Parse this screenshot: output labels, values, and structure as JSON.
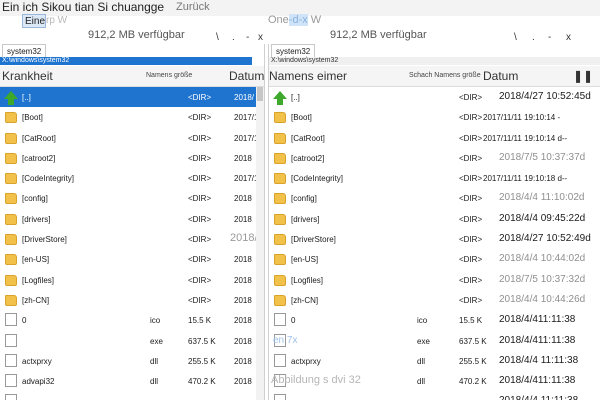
{
  "window": {
    "title": "Ein ich Sikou tian Si chuangge",
    "back_label": "Zurück"
  },
  "tabs": {
    "left_label": "Eine",
    "left_ghost": "rp W",
    "right_prefix": "One",
    "right_highlight": "-d-x",
    "right_suffix": " W"
  },
  "drive": {
    "left_free": "912,2 MB verfügbar",
    "right_free": "912,2 MB verfügbar",
    "tool_glyphs": [
      "\\",
      ".",
      "-",
      "x"
    ]
  },
  "left_panel": {
    "path_tab": "system32",
    "path": "X:\\windows\\system32",
    "headers": {
      "name": "Krankheit",
      "size": "Namens größe",
      "date": "Datum"
    },
    "rows": [
      {
        "icon": "up-arrow-icon",
        "name": "[..]",
        "type": "",
        "size": "<DIR>",
        "date": "2018/",
        "selected": true
      },
      {
        "icon": "folder-icon",
        "name": "[Boot]",
        "type": "",
        "size": "<DIR>",
        "date": "2017/1"
      },
      {
        "icon": "folder-icon",
        "name": "[CatRoot]",
        "type": "",
        "size": "<DIR>",
        "date": "2017/1"
      },
      {
        "icon": "folder-icon",
        "name": "[catroot2]",
        "type": "",
        "size": "<DIR>",
        "date": "2018"
      },
      {
        "icon": "folder-icon",
        "name": "[CodeIntegrity]",
        "type": "",
        "size": "<DIR>",
        "date": "2017/1"
      },
      {
        "icon": "folder-icon",
        "name": "[config]",
        "type": "",
        "size": "<DIR>",
        "date": "2018"
      },
      {
        "icon": "folder-icon",
        "name": "[drivers]",
        "type": "",
        "size": "<DIR>",
        "date": "2018"
      },
      {
        "icon": "folder-icon",
        "name": "[DriverStore]",
        "type": "",
        "size": "<DIR>",
        "date": "2018/"
      },
      {
        "icon": "folder-icon",
        "name": "[en-US]",
        "type": "",
        "size": "<DIR>",
        "date": "2018"
      },
      {
        "icon": "folder-icon",
        "name": "[Logfiles]",
        "type": "",
        "size": "<DIR>",
        "date": "2018"
      },
      {
        "icon": "folder-icon",
        "name": "[zh-CN]",
        "type": "",
        "size": "<DIR>",
        "date": "2018"
      },
      {
        "icon": "file-icon",
        "name": "0",
        "type": "ico",
        "size": "15.5 K",
        "date": "2018"
      },
      {
        "icon": "file-icon",
        "name": "",
        "type": "exe",
        "size": "637.5 K",
        "date": "2018"
      },
      {
        "icon": "file-icon",
        "name": "actxprxy",
        "type": "dll",
        "size": "255.5 K",
        "date": "2018"
      },
      {
        "icon": "file-icon",
        "name": "advapi32",
        "type": "dll",
        "size": "470.2 K",
        "date": "2018"
      },
      {
        "icon": "file-icon",
        "name": "",
        "type": "",
        "size": "",
        "date": ""
      }
    ]
  },
  "right_panel": {
    "path_tab": "system32",
    "path": "X:\\windows\\system32",
    "headers": {
      "name": "Namens eimer",
      "size": "Schach Namens größe",
      "date": "Datum"
    },
    "rows": [
      {
        "icon": "up-arrow-icon",
        "name": "[..]",
        "size": "<DIR>",
        "date": "2018/4/27 10:52:45d"
      },
      {
        "icon": "folder-icon",
        "name": "[Boot]",
        "size": "<DIR>",
        "date": "2017/11/11 19:10:14 -"
      },
      {
        "icon": "folder-icon",
        "name": "[CatRoot]",
        "size": "<DIR>",
        "date": "2017/11/11 19:10:14 d--"
      },
      {
        "icon": "folder-icon",
        "name": "[catroot2]",
        "size": "<DIR>",
        "date": "2018/7/5 10:37:37d"
      },
      {
        "icon": "folder-icon",
        "name": "[CodeIntegrity]",
        "size": "<DIR>",
        "date": "2017/11/11 19:10:18 d--"
      },
      {
        "icon": "folder-icon",
        "name": "[config]",
        "size": "<DIR>",
        "date": "2018/4/4 11:10:02d"
      },
      {
        "icon": "folder-icon",
        "name": "[drivers]",
        "size": "<DIR>",
        "date": "2018/4/4 09:45:22d"
      },
      {
        "icon": "folder-icon",
        "name": "[DriverStore]",
        "size": "<DIR>",
        "date": "2018/4/27 10:52:49d"
      },
      {
        "icon": "folder-icon",
        "name": "[en-US]",
        "size": "<DIR>",
        "date": "2018/4/4 10:44:02d"
      },
      {
        "icon": "folder-icon",
        "name": "[Logfiles]",
        "size": "<DIR>",
        "date": "2018/7/5 10:37:32d"
      },
      {
        "icon": "folder-icon",
        "name": "[zh-CN]",
        "size": "<DIR>",
        "date": "2018/4/4 10:44:26d"
      },
      {
        "icon": "file-icon",
        "name": "0",
        "type": "ico",
        "size": "15.5 K",
        "date": "2018/4/411:11:38"
      },
      {
        "icon": "file-icon",
        "name": "en 7x",
        "type": "exe",
        "size": "637.5 K",
        "date": "2018/4/411:11:38"
      },
      {
        "icon": "file-icon",
        "name": "actxprxy",
        "type": "dll",
        "size": "255.5 K",
        "date": "2018/4/4 11:11:38"
      },
      {
        "icon": "file-icon",
        "name": "Abbildung s dvi 32",
        "type": "dll",
        "size": "470.2 K",
        "date": "2018/4/411:11:38"
      },
      {
        "icon": "file-icon",
        "name": "",
        "type": "",
        "size": "",
        "date": "2018/4/4 11:11:38"
      }
    ]
  }
}
